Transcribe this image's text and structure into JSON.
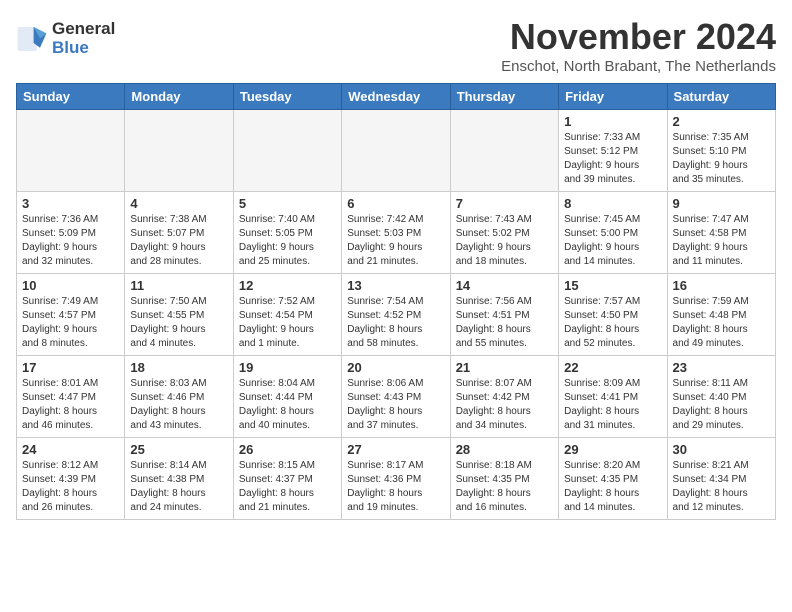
{
  "logo": {
    "line1": "General",
    "line2": "Blue"
  },
  "title": "November 2024",
  "subtitle": "Enschot, North Brabant, The Netherlands",
  "weekdays": [
    "Sunday",
    "Monday",
    "Tuesday",
    "Wednesday",
    "Thursday",
    "Friday",
    "Saturday"
  ],
  "weeks": [
    [
      {
        "day": "",
        "info": ""
      },
      {
        "day": "",
        "info": ""
      },
      {
        "day": "",
        "info": ""
      },
      {
        "day": "",
        "info": ""
      },
      {
        "day": "",
        "info": ""
      },
      {
        "day": "1",
        "info": "Sunrise: 7:33 AM\nSunset: 5:12 PM\nDaylight: 9 hours\nand 39 minutes."
      },
      {
        "day": "2",
        "info": "Sunrise: 7:35 AM\nSunset: 5:10 PM\nDaylight: 9 hours\nand 35 minutes."
      }
    ],
    [
      {
        "day": "3",
        "info": "Sunrise: 7:36 AM\nSunset: 5:09 PM\nDaylight: 9 hours\nand 32 minutes."
      },
      {
        "day": "4",
        "info": "Sunrise: 7:38 AM\nSunset: 5:07 PM\nDaylight: 9 hours\nand 28 minutes."
      },
      {
        "day": "5",
        "info": "Sunrise: 7:40 AM\nSunset: 5:05 PM\nDaylight: 9 hours\nand 25 minutes."
      },
      {
        "day": "6",
        "info": "Sunrise: 7:42 AM\nSunset: 5:03 PM\nDaylight: 9 hours\nand 21 minutes."
      },
      {
        "day": "7",
        "info": "Sunrise: 7:43 AM\nSunset: 5:02 PM\nDaylight: 9 hours\nand 18 minutes."
      },
      {
        "day": "8",
        "info": "Sunrise: 7:45 AM\nSunset: 5:00 PM\nDaylight: 9 hours\nand 14 minutes."
      },
      {
        "day": "9",
        "info": "Sunrise: 7:47 AM\nSunset: 4:58 PM\nDaylight: 9 hours\nand 11 minutes."
      }
    ],
    [
      {
        "day": "10",
        "info": "Sunrise: 7:49 AM\nSunset: 4:57 PM\nDaylight: 9 hours\nand 8 minutes."
      },
      {
        "day": "11",
        "info": "Sunrise: 7:50 AM\nSunset: 4:55 PM\nDaylight: 9 hours\nand 4 minutes."
      },
      {
        "day": "12",
        "info": "Sunrise: 7:52 AM\nSunset: 4:54 PM\nDaylight: 9 hours\nand 1 minute."
      },
      {
        "day": "13",
        "info": "Sunrise: 7:54 AM\nSunset: 4:52 PM\nDaylight: 8 hours\nand 58 minutes."
      },
      {
        "day": "14",
        "info": "Sunrise: 7:56 AM\nSunset: 4:51 PM\nDaylight: 8 hours\nand 55 minutes."
      },
      {
        "day": "15",
        "info": "Sunrise: 7:57 AM\nSunset: 4:50 PM\nDaylight: 8 hours\nand 52 minutes."
      },
      {
        "day": "16",
        "info": "Sunrise: 7:59 AM\nSunset: 4:48 PM\nDaylight: 8 hours\nand 49 minutes."
      }
    ],
    [
      {
        "day": "17",
        "info": "Sunrise: 8:01 AM\nSunset: 4:47 PM\nDaylight: 8 hours\nand 46 minutes."
      },
      {
        "day": "18",
        "info": "Sunrise: 8:03 AM\nSunset: 4:46 PM\nDaylight: 8 hours\nand 43 minutes."
      },
      {
        "day": "19",
        "info": "Sunrise: 8:04 AM\nSunset: 4:44 PM\nDaylight: 8 hours\nand 40 minutes."
      },
      {
        "day": "20",
        "info": "Sunrise: 8:06 AM\nSunset: 4:43 PM\nDaylight: 8 hours\nand 37 minutes."
      },
      {
        "day": "21",
        "info": "Sunrise: 8:07 AM\nSunset: 4:42 PM\nDaylight: 8 hours\nand 34 minutes."
      },
      {
        "day": "22",
        "info": "Sunrise: 8:09 AM\nSunset: 4:41 PM\nDaylight: 8 hours\nand 31 minutes."
      },
      {
        "day": "23",
        "info": "Sunrise: 8:11 AM\nSunset: 4:40 PM\nDaylight: 8 hours\nand 29 minutes."
      }
    ],
    [
      {
        "day": "24",
        "info": "Sunrise: 8:12 AM\nSunset: 4:39 PM\nDaylight: 8 hours\nand 26 minutes."
      },
      {
        "day": "25",
        "info": "Sunrise: 8:14 AM\nSunset: 4:38 PM\nDaylight: 8 hours\nand 24 minutes."
      },
      {
        "day": "26",
        "info": "Sunrise: 8:15 AM\nSunset: 4:37 PM\nDaylight: 8 hours\nand 21 minutes."
      },
      {
        "day": "27",
        "info": "Sunrise: 8:17 AM\nSunset: 4:36 PM\nDaylight: 8 hours\nand 19 minutes."
      },
      {
        "day": "28",
        "info": "Sunrise: 8:18 AM\nSunset: 4:35 PM\nDaylight: 8 hours\nand 16 minutes."
      },
      {
        "day": "29",
        "info": "Sunrise: 8:20 AM\nSunset: 4:35 PM\nDaylight: 8 hours\nand 14 minutes."
      },
      {
        "day": "30",
        "info": "Sunrise: 8:21 AM\nSunset: 4:34 PM\nDaylight: 8 hours\nand 12 minutes."
      }
    ]
  ]
}
